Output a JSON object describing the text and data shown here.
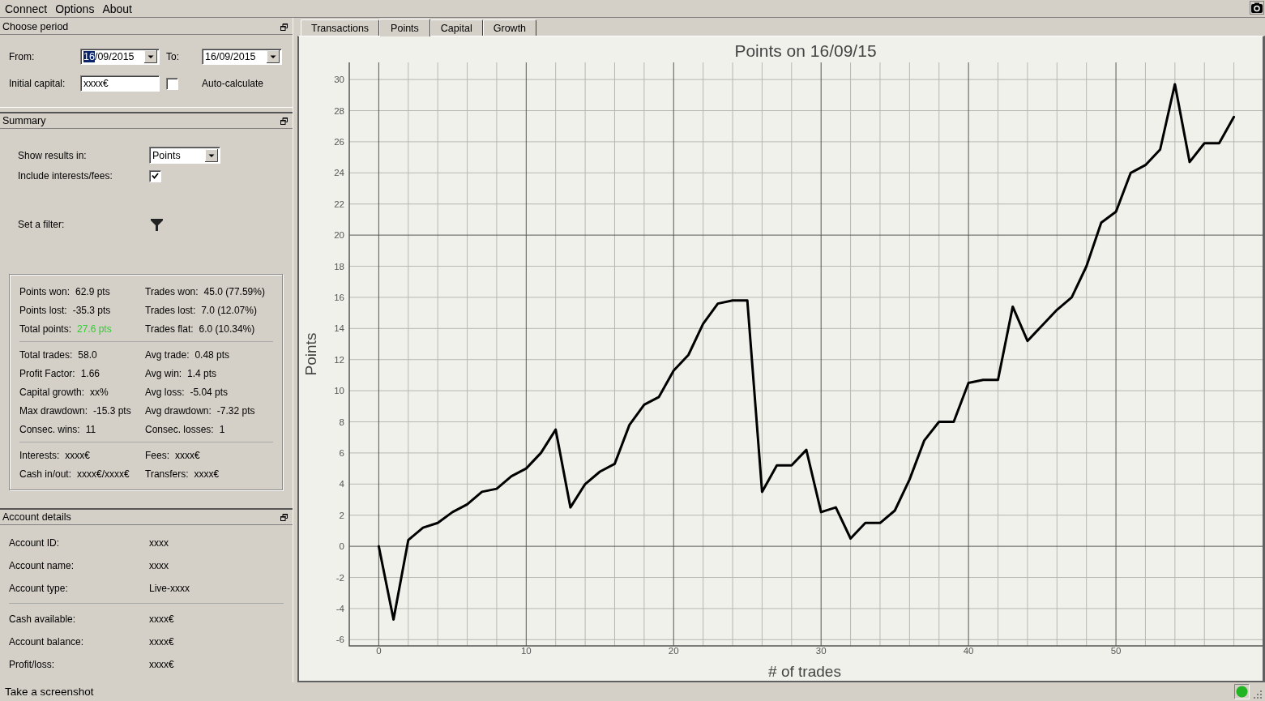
{
  "menu_bar": {
    "items": [
      "Connect",
      "Options",
      "About"
    ]
  },
  "choose_period": {
    "title": "Choose period",
    "from": {
      "label": "From:",
      "value_parts": [
        {
          "text": "16",
          "selected": true
        },
        {
          "text": "/09/2015",
          "selected": false
        }
      ]
    },
    "to": {
      "label": "To:",
      "value_parts": [
        {
          "text": "16/09/2015",
          "selected": false
        }
      ]
    },
    "initial_capital": {
      "label": "Initial capital:",
      "value": "xxxx€"
    },
    "auto_calculate": {
      "label": "Auto-calculate",
      "checked": false
    }
  },
  "summary": {
    "title": "Summary",
    "show_results_in": {
      "label": "Show results in:",
      "value": "Points"
    },
    "include_interests_fees": {
      "label": "Include interests/fees:",
      "checked": true
    },
    "filter": {
      "label": "Set a filter:"
    },
    "stats_groups": [
      [
        {
          "label": "Points won:",
          "value": "62.9 pts"
        },
        {
          "label": "Trades won:",
          "value": "45.0 (77.59%)"
        },
        {
          "label": "Points lost:",
          "value": "-35.3 pts"
        },
        {
          "label": "Trades lost:",
          "value": "7.0 (12.07%)"
        },
        {
          "label": "Total points:",
          "value": "27.6 pts",
          "color": "#33cc33"
        },
        {
          "label": "Trades flat:",
          "value": "6.0 (10.34%)"
        }
      ],
      [
        {
          "label": "Total trades:",
          "value": "58.0"
        },
        {
          "label": "Avg trade:",
          "value": "0.48 pts"
        },
        {
          "label": "Profit Factor:",
          "value": "1.66"
        },
        {
          "label": "Avg win:",
          "value": "1.4 pts"
        },
        {
          "label": "Capital growth:",
          "value": "xx%"
        },
        {
          "label": "Avg loss:",
          "value": "-5.04 pts"
        },
        {
          "label": "Max drawdown:",
          "value": "-15.3 pts"
        },
        {
          "label": "Avg drawdown:",
          "value": "-7.32 pts"
        },
        {
          "label": "Consec. wins:",
          "value": "11"
        },
        {
          "label": "Consec. losses:",
          "value": "1"
        }
      ],
      [
        {
          "label": "Interests:",
          "value": "xxxx€"
        },
        {
          "label": "Fees:",
          "value": "xxxx€"
        },
        {
          "label": "Cash in/out:",
          "value": "xxxx€/xxxx€"
        },
        {
          "label": "Transfers:",
          "value": "xxxx€"
        }
      ]
    ]
  },
  "account_details": {
    "title": "Account details",
    "groups": [
      [
        {
          "label": "Account ID:",
          "value": "xxxx"
        },
        {
          "label": "Account name:",
          "value": "xxxx"
        },
        {
          "label": "Account type:",
          "value": "Live-xxxx"
        }
      ],
      [
        {
          "label": "Cash available:",
          "value": "xxxx€"
        },
        {
          "label": "Account balance:",
          "value": "xxxx€"
        },
        {
          "label": "Profit/loss:",
          "value": "xxxx€"
        }
      ]
    ]
  },
  "chart_panel": {
    "tabs": [
      {
        "label": "Transactions",
        "selected": false
      },
      {
        "label": "Points",
        "selected": true
      },
      {
        "label": "Capital",
        "selected": false
      },
      {
        "label": "Growth",
        "selected": false
      }
    ],
    "chart_data": {
      "type": "line",
      "title": "Points on 16/09/15",
      "xlabel": "# of trades",
      "ylabel": "Points",
      "x": [
        0,
        1,
        2,
        3,
        4,
        5,
        6,
        7,
        8,
        9,
        10,
        11,
        12,
        13,
        14,
        15,
        16,
        17,
        18,
        19,
        20,
        21,
        22,
        23,
        24,
        25,
        26,
        27,
        28,
        29,
        30,
        31,
        32,
        33,
        34,
        35,
        36,
        37,
        38,
        39,
        40,
        41,
        42,
        43,
        44,
        45,
        46,
        47,
        48,
        49,
        50,
        51,
        52,
        53,
        54,
        55,
        56,
        57,
        58
      ],
      "series": [
        {
          "color": "#000000",
          "values": [
            0,
            -4.7,
            0.4,
            1.2,
            1.5,
            2.2,
            2.7,
            3.5,
            3.7,
            4.5,
            5.0,
            6.0,
            7.5,
            2.5,
            4.0,
            4.8,
            5.3,
            7.8,
            9.1,
            9.6,
            11.3,
            12.3,
            14.3,
            15.6,
            15.8,
            15.8,
            3.5,
            5.2,
            5.2,
            6.2,
            2.2,
            2.5,
            0.5,
            1.5,
            1.5,
            2.3,
            4.3,
            6.8,
            8.0,
            8.0,
            10.5,
            10.7,
            10.7,
            15.4,
            13.2,
            14.2,
            15.2,
            16.0,
            18.0,
            20.8,
            21.5,
            24.0,
            24.5,
            25.5,
            29.7,
            24.7,
            25.9,
            25.9,
            27.6
          ]
        }
      ],
      "xlim": [
        -2,
        60
      ],
      "ylim": [
        -6.4,
        31.1
      ],
      "xticks": [
        0,
        10,
        20,
        30,
        40,
        50
      ],
      "yticks": [
        -6,
        -4,
        -2,
        0,
        2,
        4,
        6,
        8,
        10,
        12,
        14,
        16,
        18,
        20,
        22,
        24,
        26,
        28,
        30
      ],
      "grid": true
    }
  },
  "status_bar": {
    "message": "Take a screenshot",
    "indicator_on": true
  }
}
